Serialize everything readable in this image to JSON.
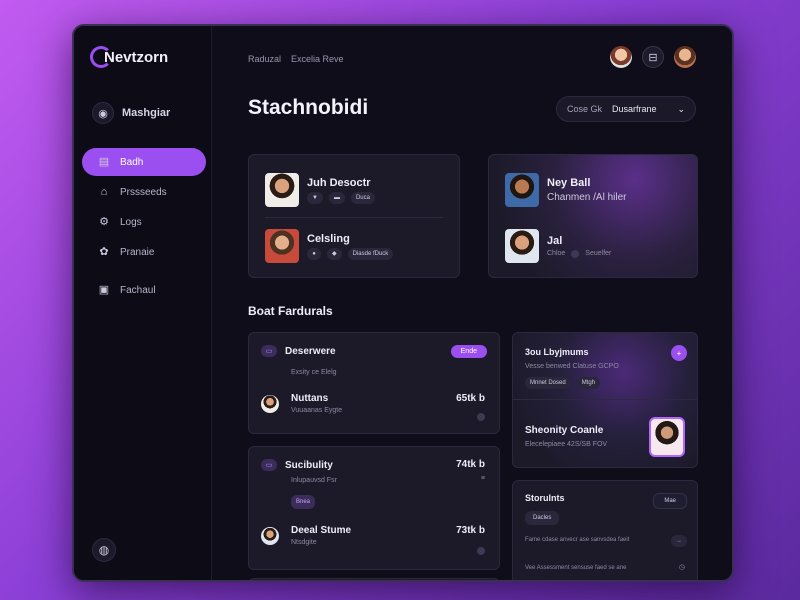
{
  "app": {
    "name": "Nevtzorn"
  },
  "sidebar": {
    "user_label": "Mashgiar",
    "items": [
      {
        "label": "Badh",
        "icon": "inbox-icon"
      },
      {
        "label": "Prssseeds",
        "icon": "home-icon"
      },
      {
        "label": "Logs",
        "icon": "settings-icon"
      },
      {
        "label": "Pranaie",
        "icon": "gear-icon"
      },
      {
        "label": "Fachaul",
        "icon": "document-icon"
      }
    ]
  },
  "header": {
    "crumbs": [
      "Raduzal",
      "Excelia Reve"
    ],
    "title": "Stachnobidi",
    "dropdown": {
      "label": "Cose Gk",
      "value": "Dusarfrane"
    }
  },
  "people_card_left": {
    "rows": [
      {
        "name": "Juh Desoctr",
        "chips": [
          "▼",
          "▬",
          "Duca"
        ]
      },
      {
        "name": "Celsling",
        "chips": [
          "●",
          "◆",
          "Diasde fDuck"
        ]
      }
    ]
  },
  "people_card_right": {
    "rows": [
      {
        "name": "Ney Ball",
        "subtitle": "Chanmen /Al hiler"
      },
      {
        "name": "Jal",
        "chips": [
          "Chloe",
          "Seuelfer"
        ]
      }
    ]
  },
  "section_title": "Boat Fardurals",
  "feature_card_1": {
    "title": "Deserwere",
    "subtitle": "Exsity ce Elelg",
    "button": "Ende",
    "row2": {
      "name": "Nuttans",
      "sub": "Vuuaanas Eygte",
      "amount": "65tk b"
    }
  },
  "feature_card_2": {
    "title": "Sucibulity",
    "subtitle": "Inlupauvsd Fsr",
    "button": "Bnea",
    "row2": {
      "name": "Deeal Stume",
      "sub": "Ntsdgite",
      "amount": "73tk b"
    },
    "amount": "74tk b"
  },
  "side_card_1": {
    "title": "3ou Lbyjmums",
    "line": "Vesse benwed Clatuse GCPO",
    "chips": [
      "Mnnet Dosed",
      "Mtgh"
    ],
    "highlight_title": "Sheonity Coanle",
    "highlight_sub": "Elecelepiaee 42S/SB FOV"
  },
  "side_card_2": {
    "title": "Storulnts",
    "button": "Mae",
    "chip": "Dacles",
    "lines": [
      "Fame cdase anvecr ase sanvsdea faeit",
      "Vee Assessment sensuse faed se ane"
    ]
  }
}
